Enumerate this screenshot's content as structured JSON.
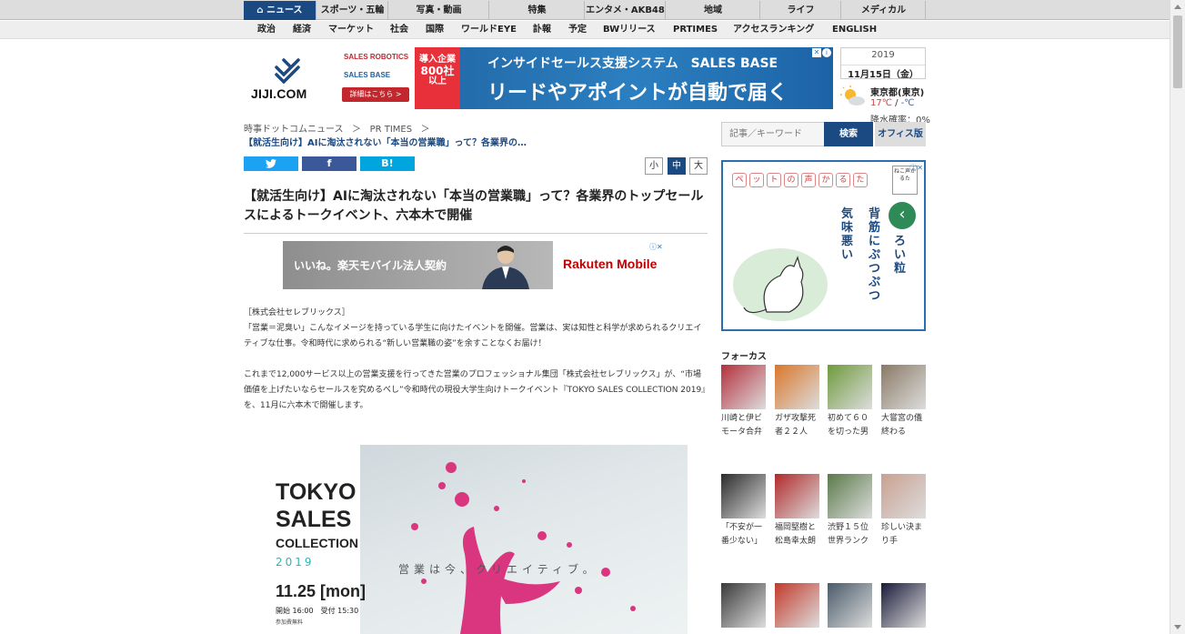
{
  "nav": {
    "main": [
      "ニュース",
      "スポーツ・五輪",
      "写真・動画",
      "特集",
      "エンタメ・AKB48",
      "地域",
      "ライフ",
      "メディカル"
    ],
    "sub": [
      "政治",
      "経済",
      "マーケット",
      "社会",
      "国際",
      "ワールドEYE",
      "訃報",
      "予定",
      "BWリリース",
      "PRTIMES",
      "アクセスランキング",
      "ENGLISH"
    ]
  },
  "logo": {
    "text": "JIJI.COM"
  },
  "topad": {
    "brand": "SALES ROBOTICS",
    "brand2": "SALES BASE",
    "btn": "詳細はこちら >",
    "red": [
      "導入企業",
      "800社",
      "以上"
    ],
    "line1": "インサイドセールス支援システム　SALES BASE",
    "line2": "リードやアポイントが自動で届く"
  },
  "date": {
    "year": "2019",
    "day": "11月15日（金）"
  },
  "weather": {
    "city": "東京都(東京)",
    "hi": "17℃",
    "sep": " / ",
    "lo": "-℃",
    "rain": "降水確率：0%"
  },
  "breadcrumb": {
    "root": "時事ドットコムニュース",
    "sep1": "＞",
    "section": "PR TIMES",
    "sep2": "＞",
    "current": "【就活生向け】AIに淘汰されない「本当の営業職」って？各業界の…"
  },
  "share": {
    "twitter": "twitter-icon",
    "facebook": "f",
    "hatena": "B!"
  },
  "fontsize": {
    "small": "小",
    "medium": "中",
    "large": "大"
  },
  "article": {
    "headline": "【就活生向け】AIに淘汰されない「本当の営業職」って？各業界のトップセールスによるトークイベント、六本木で開催",
    "p1": "［株式会社セレブリックス］",
    "p2": "「営業＝泥臭い」こんなイメージを持っている学生に向けたイベントを開催。営業は、実は知性と科学が求められるクリエイティブな仕事。令和時代に求められる“新しい営業職の姿”を余すことなくお届け！",
    "p3": "これまで12,000サービス以上の営業支援を行ってきた営業のプロフェッショナル集団「株式会社セレブリックス」が、“市場価値を上げたいならセールスを究めるべし”令和時代の現役大学生向けトークイベント『TOKYO SALES COLLECTION 2019』を、11月に六本木で開催します。"
  },
  "midad": {
    "text": "いいね。楽天モバイル法人契約",
    "brand": "Rakuten Mobile"
  },
  "hero": {
    "t1": "TOKYO",
    "t2": "SALES",
    "t3": "COLLECTION",
    "t4": "2019",
    "t5": "11.25 [mon]",
    "t6": "開始 16:00　受付 15:30",
    "t7": "参加費無料",
    "tag": "営業は今、クリエイティブ。"
  },
  "search": {
    "placeholder": "記事／キーワード",
    "button": "検索",
    "office": "オフィス版"
  },
  "sidead": {
    "title": [
      "ペ",
      "ッ",
      "ト",
      "の",
      "声",
      "か",
      "る",
      "た"
    ],
    "brand": "ねこ声かるた",
    "v1": "気味悪い",
    "v2": "背筋にぷつぷつ",
    "v3": "ろい粒"
  },
  "focus": {
    "title": "フォーカス",
    "items": [
      {
        "cap": "川崎と伊ビモータ合弁",
        "color": "#b3303c"
      },
      {
        "cap": "ガザ攻撃死者２２人",
        "color": "#d9772b"
      },
      {
        "cap": "初めて６０を切った男",
        "color": "#6f9a3d"
      },
      {
        "cap": "大嘗宮の儀終わる",
        "color": "#8a7a66"
      },
      {
        "cap": "「不安が一番少ない」",
        "color": "#2b2b2b"
      },
      {
        "cap": "福岡堅樹と松島幸太朗",
        "color": "#b02a2a"
      },
      {
        "cap": "渋野１５位世界ランク",
        "color": "#5a7a4a"
      },
      {
        "cap": "珍しい決まり手",
        "color": "#c9a090"
      },
      {
        "cap": "",
        "color": "#3a3a3a"
      },
      {
        "cap": "",
        "color": "#c23a2a"
      },
      {
        "cap": "",
        "color": "#4a5a6a"
      },
      {
        "cap": "",
        "color": "#1a1a3a"
      }
    ]
  },
  "colors": {
    "navy": "#1b4a82",
    "twitter": "#1da1f2",
    "facebook": "#3b5998",
    "hatena": "#00a4de"
  }
}
